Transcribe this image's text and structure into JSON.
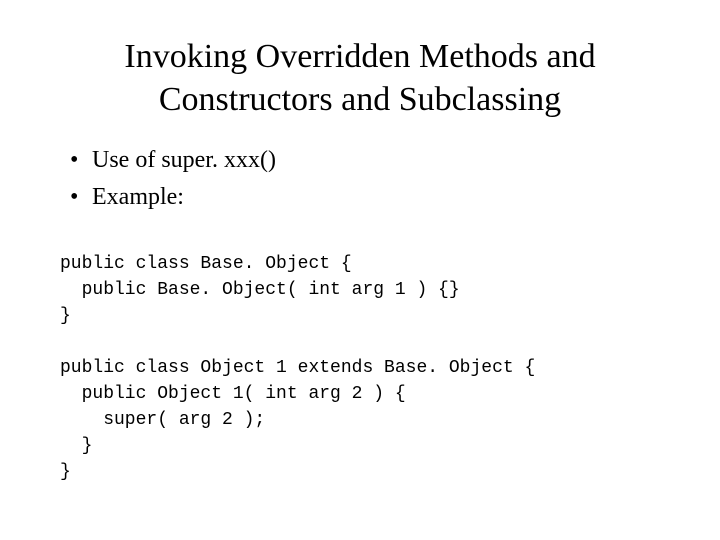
{
  "title_line1": "Invoking Overridden Methods and",
  "title_line2": "Constructors and Subclassing",
  "bullets": {
    "b0": "Use of super. xxx()",
    "b1": "Example:"
  },
  "code": {
    "l0": "public class Base. Object {",
    "l1": "  public Base. Object( int arg 1 ) {}",
    "l2": "}",
    "l3": "",
    "l4": "public class Object 1 extends Base. Object {",
    "l5": "  public Object 1( int arg 2 ) {",
    "l6": "    super( arg 2 );",
    "l7": "  }",
    "l8": "}"
  }
}
